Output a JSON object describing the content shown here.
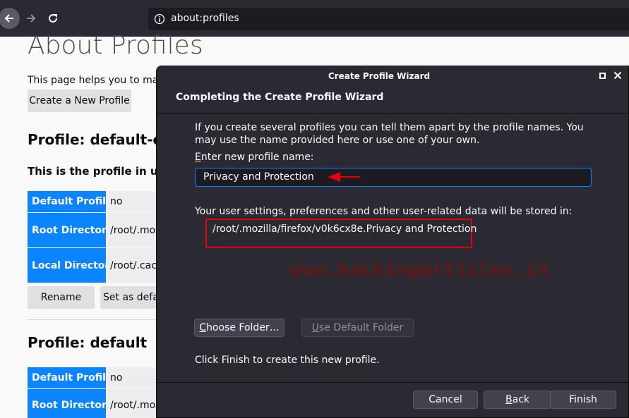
{
  "browser": {
    "url": "about:profiles"
  },
  "page": {
    "title": "About Profiles",
    "description": "This page helps you to man",
    "create_button": "Create a New Profile",
    "profile1": {
      "title": "Profile: default-es",
      "note": "This is the profile in use",
      "rows": [
        {
          "label": "Default Profile",
          "value": "no"
        },
        {
          "label": "Root Directory",
          "value": "/root/.moz"
        },
        {
          "label": "Local Directory",
          "value": "/root/.cach"
        }
      ],
      "rename_button": "Rename",
      "set_default_button": "Set as defau"
    },
    "profile2": {
      "title": "Profile: default",
      "rows": [
        {
          "label": "Default Profile",
          "value": "no"
        },
        {
          "label": "Root Directory",
          "value": "/root/.moz"
        }
      ]
    }
  },
  "dialog": {
    "title": "Create Profile Wizard",
    "header": "Completing the Create Profile Wizard",
    "description": "If you create several profiles you can tell them apart by the profile names. You may use the name provided here or use one of your own.",
    "enter_label_mnemonic": "E",
    "enter_label_rest": "nter new profile name:",
    "profile_name_value": "Privacy and Protection",
    "stored_label": "Your user settings, preferences and other user-related data will be stored in:",
    "stored_path": "/root/.mozilla/firefox/v0k6cx8e.Privacy and Protection",
    "choose_folder_mnemonic": "C",
    "choose_folder_rest": "hoose Folder…",
    "use_default_mnemonic": "U",
    "use_default_rest": "se Default Folder",
    "finish_text": "Click Finish to create this new profile.",
    "cancel_button": "Cancel",
    "back_mnemonic": "B",
    "back_rest": "ack",
    "finish_button": "Finish"
  },
  "watermark": "www.hackingarticles.in",
  "colors": {
    "accent": "#0a84ff",
    "annotation_red": "#e3000f",
    "dialog_bg": "#2b2a33"
  },
  "icons": {
    "back": "arrow-left-icon",
    "forward": "arrow-right-icon",
    "reload": "reload-icon",
    "info": "info-icon",
    "maximize": "maximize-icon",
    "close": "close-icon"
  }
}
